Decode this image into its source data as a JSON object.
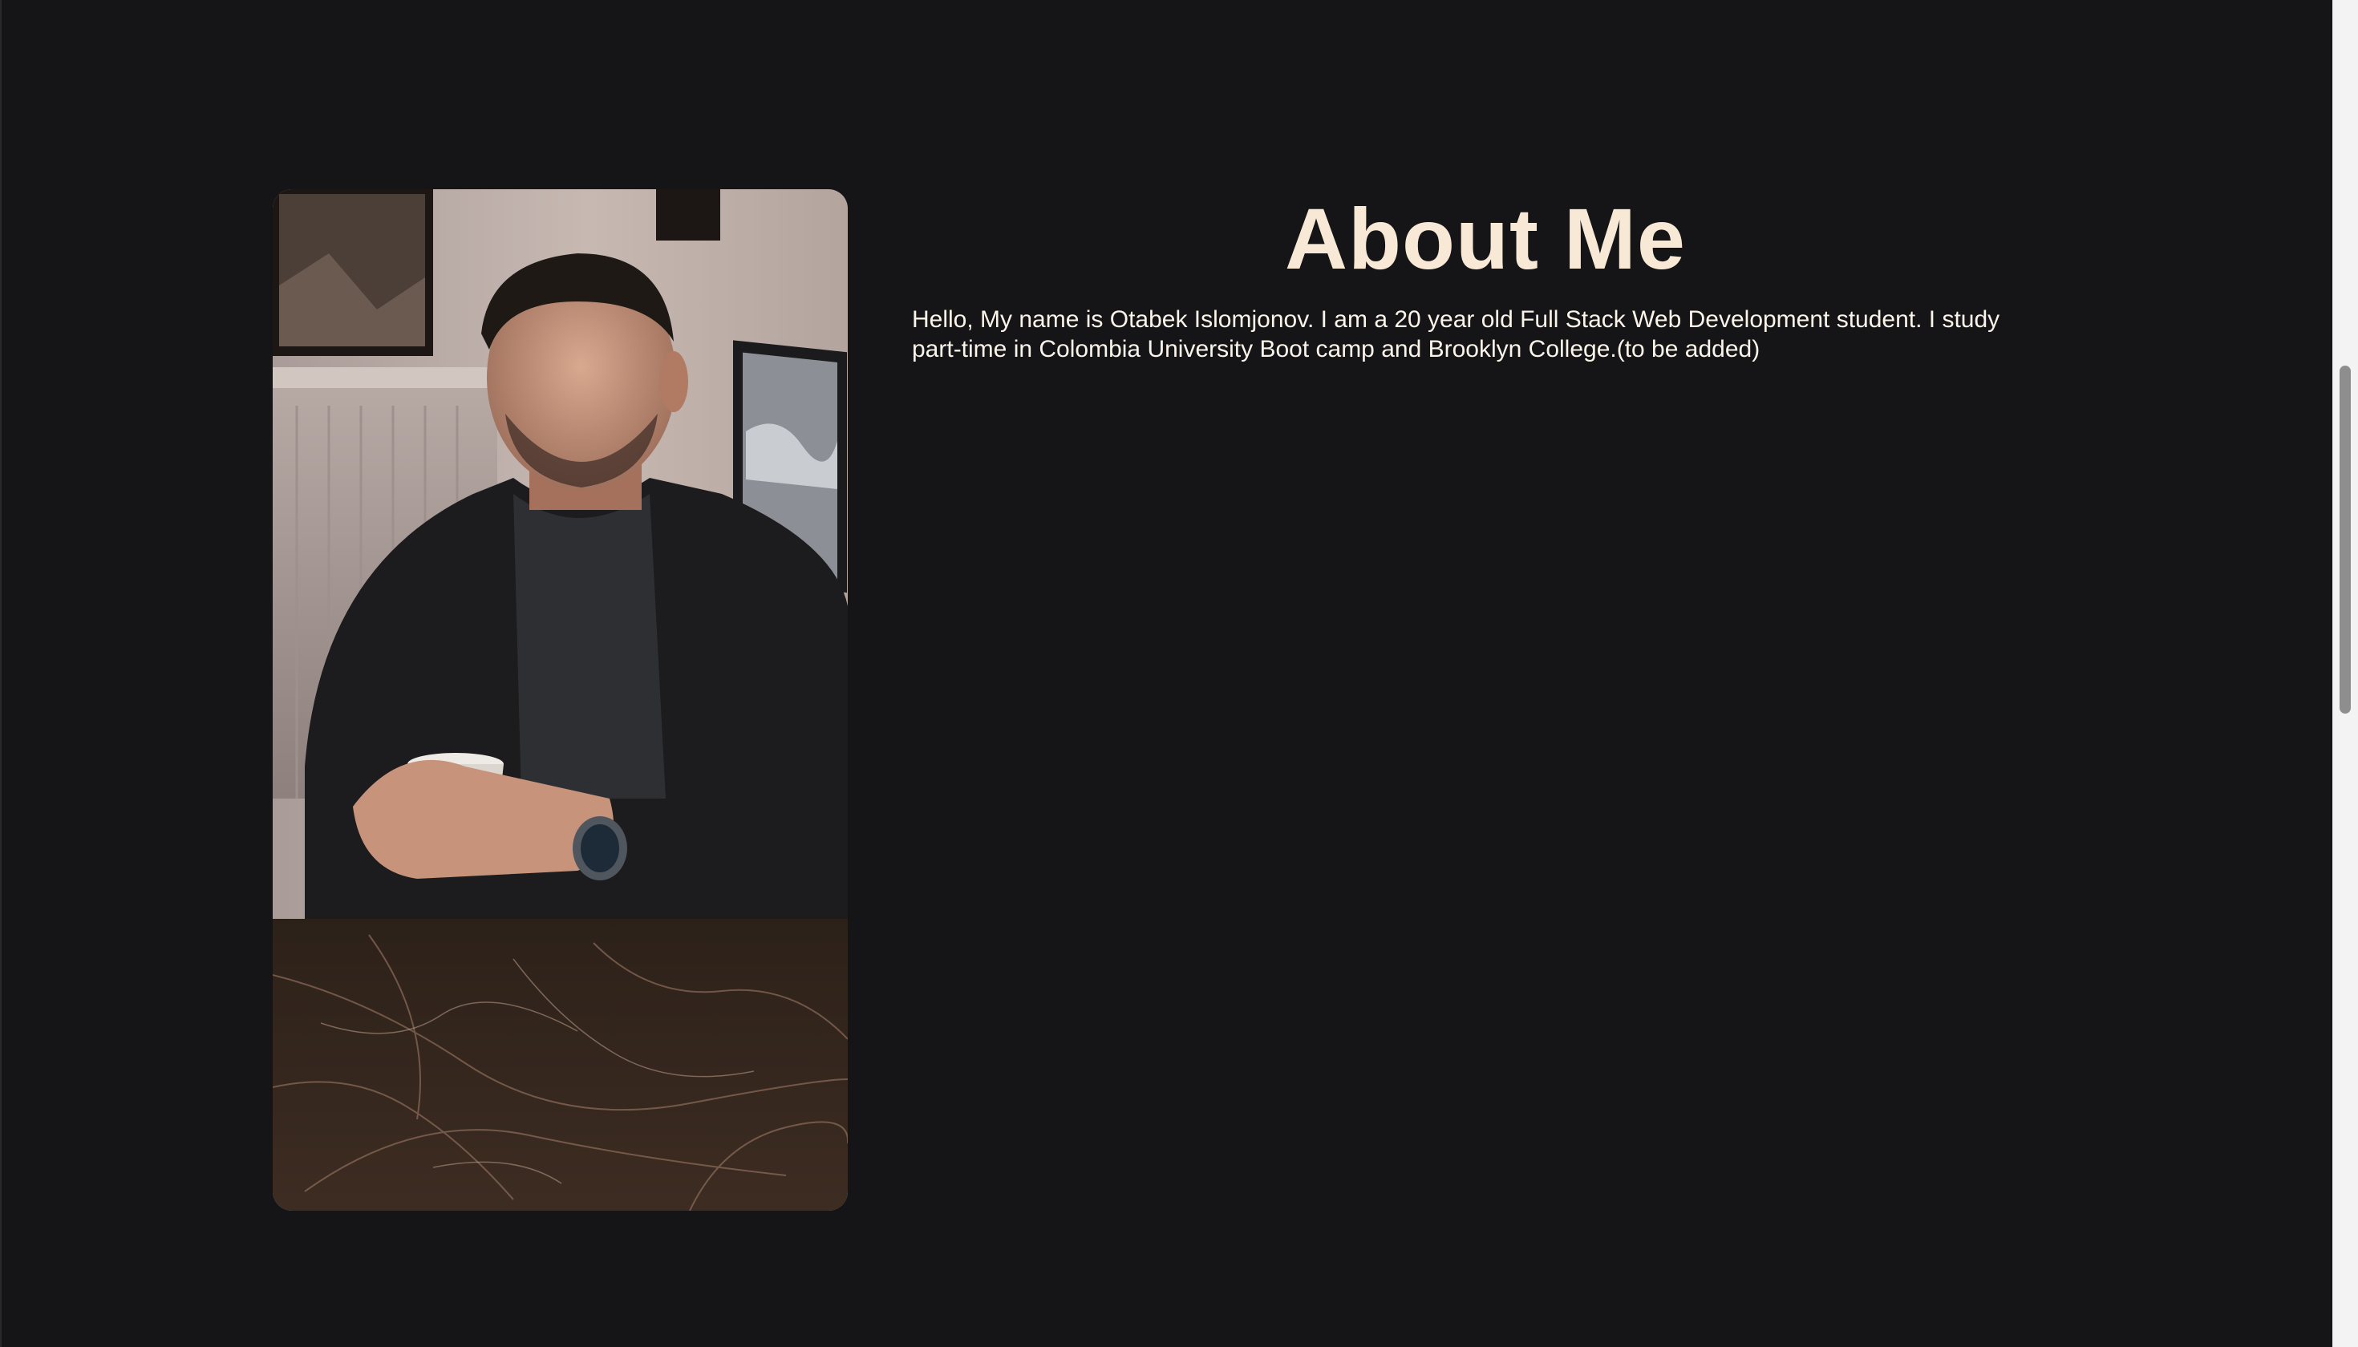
{
  "about": {
    "heading": "About Me",
    "bio": "Hello, My name is Otabek Islomjonov. I am a 20 year old Full Stack Web Development student. I study part-time in Colombia University Boot camp and Brooklyn College.(to be added)"
  },
  "photo": {
    "alt": "Portrait photo of a man sitting at a marble table holding a coffee cup"
  },
  "colors": {
    "background": "#151416",
    "heading": "#f7e9d6",
    "text": "#fbf4ea"
  }
}
